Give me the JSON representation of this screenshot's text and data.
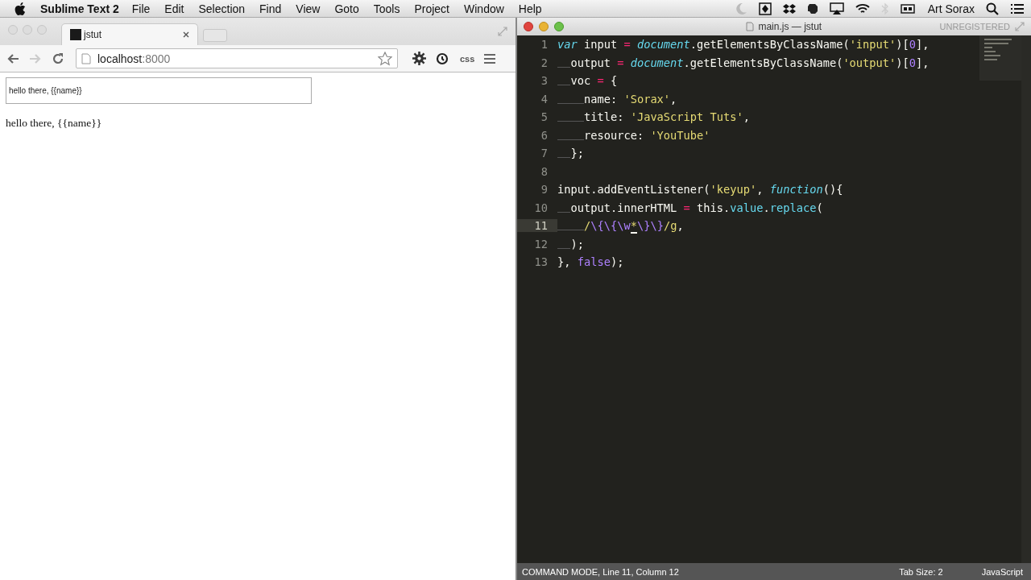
{
  "menu_bar": {
    "app_name": "Sublime Text 2",
    "items": [
      "File",
      "Edit",
      "Selection",
      "Find",
      "View",
      "Goto",
      "Tools",
      "Project",
      "Window",
      "Help"
    ],
    "user": "Art Sorax"
  },
  "browser": {
    "tabs": [
      {
        "title": "jstut",
        "selected": true
      }
    ],
    "url": {
      "host": "localhost",
      "port": ":8000"
    },
    "extension_label": "css",
    "page": {
      "input": {
        "value": "hello there, {{name}}"
      },
      "output": "hello there, {{name}}"
    }
  },
  "editor": {
    "title": "main.js — jstut",
    "license": "UNREGISTERED",
    "lines": [
      {
        "number": "1",
        "current": false,
        "tokens": [
          {
            "kind": "keyword",
            "text": "var"
          },
          {
            "kind": "plain",
            "text": " input "
          },
          {
            "kind": "operator",
            "text": "= "
          },
          {
            "kind": "builtin",
            "text": "document"
          },
          {
            "kind": "plain",
            "text": ".getElementsByClassName("
          },
          {
            "kind": "string",
            "text": "'input'"
          },
          {
            "kind": "plain",
            "text": ")["
          },
          {
            "kind": "number",
            "text": "0"
          },
          {
            "kind": "plain",
            "text": "],"
          }
        ]
      },
      {
        "number": "2",
        "current": false,
        "tokens": [
          {
            "kind": "plain",
            "text": "  output "
          },
          {
            "kind": "operator",
            "text": "= "
          },
          {
            "kind": "builtin",
            "text": "document"
          },
          {
            "kind": "plain",
            "text": ".getElementsByClassName("
          },
          {
            "kind": "string",
            "text": "'output'"
          },
          {
            "kind": "plain",
            "text": ")["
          },
          {
            "kind": "number",
            "text": "0"
          },
          {
            "kind": "plain",
            "text": "],"
          }
        ]
      },
      {
        "number": "3",
        "current": false,
        "tokens": [
          {
            "kind": "plain",
            "text": "  voc "
          },
          {
            "kind": "operator",
            "text": "="
          },
          {
            "kind": "plain",
            "text": " {"
          }
        ]
      },
      {
        "number": "4",
        "current": false,
        "tokens": [
          {
            "kind": "plain",
            "text": "    name: "
          },
          {
            "kind": "string",
            "text": "'Sorax'"
          },
          {
            "kind": "plain",
            "text": ","
          }
        ]
      },
      {
        "number": "5",
        "current": false,
        "tokens": [
          {
            "kind": "plain",
            "text": "    title: "
          },
          {
            "kind": "string",
            "text": "'JavaScript Tuts'"
          },
          {
            "kind": "plain",
            "text": ","
          }
        ]
      },
      {
        "number": "6",
        "current": false,
        "tokens": [
          {
            "kind": "plain",
            "text": "    resource: "
          },
          {
            "kind": "string",
            "text": "'YouTube'"
          }
        ]
      },
      {
        "number": "7",
        "current": false,
        "tokens": [
          {
            "kind": "plain",
            "text": "  };"
          }
        ]
      },
      {
        "number": "8",
        "current": false
      },
      {
        "number": "9",
        "current": false,
        "tokens": [
          {
            "kind": "plain",
            "text": "input.addEventListener("
          },
          {
            "kind": "string",
            "text": "'keyup'"
          },
          {
            "kind": "plain",
            "text": ", "
          },
          {
            "kind": "function",
            "text": "function"
          },
          {
            "kind": "plain",
            "text": "(){"
          }
        ]
      },
      {
        "number": "10",
        "current": false,
        "tokens": [
          {
            "kind": "plain",
            "text": "  output.innerHTML "
          },
          {
            "kind": "operator",
            "text": "="
          },
          {
            "kind": "plain",
            "text": " this."
          },
          {
            "kind": "method",
            "text": "value"
          },
          {
            "kind": "plain",
            "text": "."
          },
          {
            "kind": "method",
            "text": "replace"
          },
          {
            "kind": "plain",
            "text": "("
          }
        ]
      },
      {
        "number": "11",
        "current": true,
        "tokens": [
          {
            "kind": "string",
            "text": "    /"
          },
          {
            "kind": "regex",
            "text": "\\{\\{\\w"
          },
          {
            "kind": "cursor",
            "text": "*"
          },
          {
            "kind": "regex",
            "text": "\\}\\}"
          },
          {
            "kind": "string",
            "text": "/g"
          },
          {
            "kind": "plain",
            "text": ","
          }
        ]
      },
      {
        "number": "12",
        "current": false,
        "tokens": [
          {
            "kind": "plain",
            "text": "  );"
          }
        ]
      },
      {
        "number": "13",
        "current": false,
        "tokens": [
          {
            "kind": "plain",
            "text": "}, "
          },
          {
            "kind": "number",
            "text": "false"
          },
          {
            "kind": "plain",
            "text": ");"
          }
        ]
      }
    ],
    "status": {
      "mode": "COMMAND MODE, Line 11, Column 12",
      "tab_size": "Tab Size: 2",
      "syntax": "JavaScript"
    }
  }
}
